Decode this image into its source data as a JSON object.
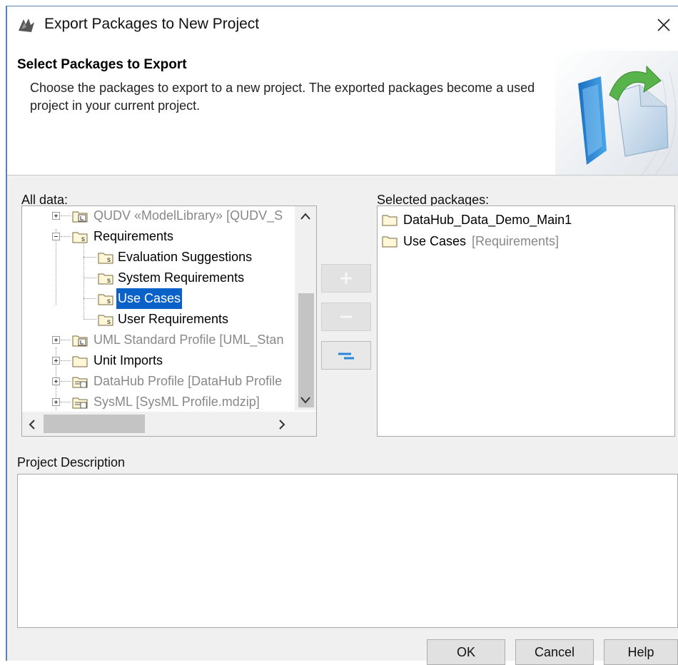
{
  "window": {
    "title": "Export Packages to New Project"
  },
  "header": {
    "title": "Select Packages to Export",
    "description": "Choose the packages to export to a new project. The exported packages become a used project in your current project."
  },
  "all_data": {
    "label": "All data:",
    "tree": [
      {
        "label": "QUDV «ModelLibrary» [QUDV_S",
        "dim": true
      },
      {
        "label": "Requirements"
      },
      {
        "label": "Evaluation Suggestions"
      },
      {
        "label": "System Requirements"
      },
      {
        "label": "Use Cases",
        "selected": true
      },
      {
        "label": "User Requirements"
      },
      {
        "label": "UML Standard Profile [UML_Stan",
        "dim": true
      },
      {
        "label": "Unit Imports"
      },
      {
        "label": "DataHub Profile [DataHub Profile",
        "dim": true
      },
      {
        "label": "SysML [SysML Profile.mdzip]",
        "dim": true
      }
    ]
  },
  "selected_packages": {
    "label": "Selected packages:",
    "items": [
      {
        "name": "DataHub_Data_Demo_Main1",
        "suffix": ""
      },
      {
        "name": "Use Cases",
        "suffix": "[Requirements]"
      }
    ]
  },
  "project_description": {
    "label": "Project Description",
    "value": ""
  },
  "buttons": {
    "ok": "OK",
    "cancel": "Cancel",
    "help": "Help"
  },
  "colors": {
    "selection": "#0a62c9",
    "accent_blue": "#2a86d8"
  }
}
